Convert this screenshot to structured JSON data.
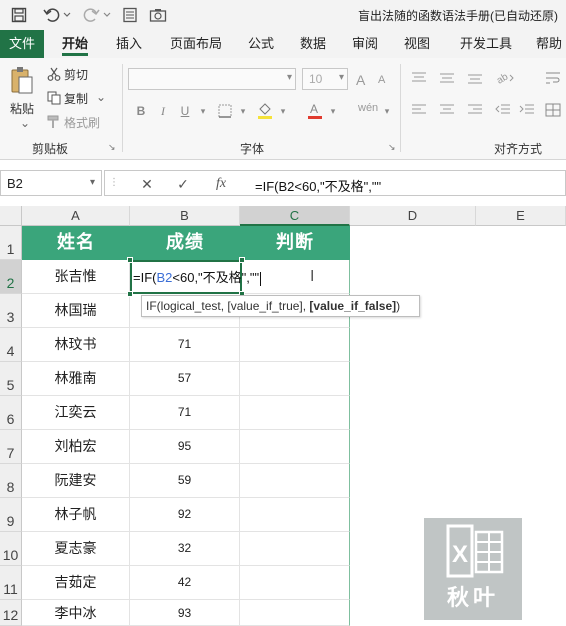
{
  "window": {
    "title": "盲出法随的函数语法手册(已自动还原)"
  },
  "quick_access": {
    "icons": [
      "save-icon",
      "undo-icon",
      "redo-icon",
      "form-icon",
      "camera-icon"
    ]
  },
  "ribbon": {
    "tabs": [
      "文件",
      "开始",
      "插入",
      "页面布局",
      "公式",
      "数据",
      "审阅",
      "视图",
      "开发工具",
      "帮助"
    ],
    "active_tab": "开始",
    "clipboard": {
      "paste": "粘贴",
      "cut": "剪切",
      "copy": "复制",
      "format_painter": "格式刷",
      "group_label": "剪贴板"
    },
    "font": {
      "size": "10",
      "group_label": "字体"
    },
    "alignment": {
      "group_label": "对齐方式"
    }
  },
  "formula_bar": {
    "name_box": "B2",
    "cancel_symbol": "✕",
    "enter_symbol": "✓",
    "fx_label": "fx",
    "formula": "=IF(B2<60,\"不及格\",\"\""
  },
  "sheet": {
    "columns": [
      "A",
      "B",
      "C",
      "D",
      "E"
    ],
    "selected_column": "C",
    "rows": [
      "1",
      "2",
      "3",
      "4",
      "5",
      "6",
      "7",
      "8",
      "9",
      "10",
      "11",
      "12"
    ],
    "selected_row": "2",
    "headers": [
      "姓名",
      "成绩",
      "判断"
    ],
    "records": [
      {
        "name": "张吉惟",
        "score": ""
      },
      {
        "name": "林国瑞",
        "score": ""
      },
      {
        "name": "林玟书",
        "score": "71"
      },
      {
        "name": "林雅南",
        "score": "57"
      },
      {
        "name": "江奕云",
        "score": "71"
      },
      {
        "name": "刘柏宏",
        "score": "95"
      },
      {
        "name": "阮建安",
        "score": "59"
      },
      {
        "name": "林子帆",
        "score": "92"
      },
      {
        "name": "夏志豪",
        "score": "32"
      },
      {
        "name": "吉茹定",
        "score": "42"
      },
      {
        "name": "李中冰",
        "score": "93"
      }
    ],
    "in_cell_edit": {
      "prefix": "=IF(",
      "ref": "B2",
      "suffix": "<60,\"不及格\",\"\""
    },
    "tooltip": {
      "head": "IF(logical_test, [value_if_true], ",
      "bold": "[value_if_false]",
      "tail": ")"
    }
  },
  "watermark": {
    "text": "秋叶",
    "accent": "#217346"
  }
}
